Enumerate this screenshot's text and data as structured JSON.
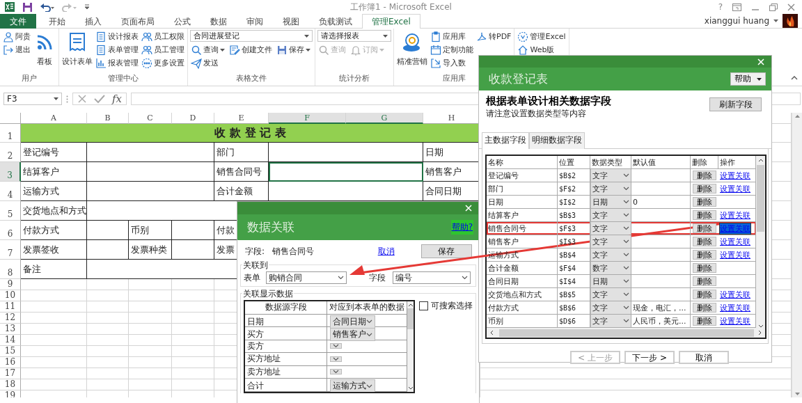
{
  "title_bar": {
    "title": "工作簿1 - Microsoft Excel",
    "help": "?",
    "user": "xianggui huang"
  },
  "ribbon_tabs": [
    {
      "label": "文件",
      "kind": "file",
      "selected": false
    },
    {
      "label": "开始",
      "kind": "tab",
      "selected": false
    },
    {
      "label": "插入",
      "kind": "tab",
      "selected": false
    },
    {
      "label": "页面布局",
      "kind": "tab",
      "selected": false
    },
    {
      "label": "公式",
      "kind": "tab",
      "selected": false
    },
    {
      "label": "数据",
      "kind": "tab",
      "selected": false
    },
    {
      "label": "审阅",
      "kind": "tab",
      "selected": false
    },
    {
      "label": "视图",
      "kind": "tab",
      "selected": false
    },
    {
      "label": "负载测试",
      "kind": "tab",
      "selected": false
    },
    {
      "label": "管理Excel",
      "kind": "tab",
      "selected": true
    }
  ],
  "ribbon_groups": [
    {
      "label": "用户",
      "columns": [
        [
          {
            "label": "阿贵",
            "kind": "small",
            "disabled": false
          },
          {
            "label": "退出",
            "kind": "small",
            "disabled": false
          }
        ],
        [
          {
            "label": "看板",
            "kind": "large",
            "disabled": false
          }
        ]
      ]
    },
    {
      "label": "管理中心",
      "columns": [
        [
          {
            "label": "设计表单",
            "kind": "large",
            "disabled": false
          }
        ],
        [
          {
            "label": "设计报表",
            "kind": "small",
            "disabled": false
          },
          {
            "label": "表单管理",
            "kind": "small",
            "disabled": false
          },
          {
            "label": "报表管理",
            "kind": "small",
            "disabled": false
          }
        ],
        [
          {
            "label": "员工权限",
            "kind": "small",
            "disabled": false
          },
          {
            "label": "员工管理",
            "kind": "small",
            "disabled": false
          },
          {
            "label": "更多设置",
            "kind": "small",
            "disabled": false
          }
        ]
      ]
    },
    {
      "label": "表格文件",
      "items": [
        {
          "label": "合同进展登记",
          "kind": "combo",
          "disabled": false
        },
        {
          "label": "查询",
          "kind": "split",
          "disabled": false
        },
        {
          "label": "创建文件",
          "kind": "small",
          "disabled": false
        },
        {
          "label": "保存",
          "kind": "split",
          "disabled": false
        },
        {
          "label": "发送",
          "kind": "small",
          "disabled": false
        }
      ]
    },
    {
      "label": "统计分析",
      "items": [
        {
          "label": "请选择报表",
          "kind": "combo",
          "disabled": false
        },
        {
          "label": "查询",
          "kind": "small",
          "disabled": true
        },
        {
          "label": "订阅",
          "kind": "split",
          "disabled": true
        }
      ]
    },
    {
      "label": "应用库",
      "columns": [
        [
          {
            "label": "精准营销",
            "kind": "large",
            "disabled": false
          }
        ],
        [
          {
            "label": "应用库",
            "kind": "small",
            "disabled": false
          },
          {
            "label": "定制功能",
            "kind": "small",
            "disabled": false
          },
          {
            "label": "导入数",
            "kind": "small",
            "disabled": false
          }
        ],
        [
          {
            "label": "转PDF",
            "kind": "small",
            "disabled": false
          }
        ]
      ]
    },
    {
      "columns": [
        [
          {
            "label": "管理Excel",
            "kind": "small",
            "disabled": false
          },
          {
            "label": "Web版",
            "kind": "small",
            "disabled": false
          }
        ]
      ]
    }
  ],
  "formula_bar": {
    "name_box": "F3",
    "function_label": "fx"
  },
  "sheet": {
    "columns": [
      {
        "label": "A",
        "selected": false
      },
      {
        "label": "B",
        "selected": false
      },
      {
        "label": "C",
        "selected": false
      },
      {
        "label": "D",
        "selected": false
      },
      {
        "label": "E",
        "selected": false
      },
      {
        "label": "F",
        "selected": true
      },
      {
        "label": "G",
        "selected": true
      },
      {
        "label": "H",
        "selected": false
      }
    ],
    "rows": [
      {
        "label": "1",
        "kind": "title",
        "selected": false,
        "cells": [
          {
            "text": "收 款 登 记 表",
            "selected": false
          }
        ]
      },
      {
        "label": "2",
        "kind": "pair",
        "selected": false,
        "cells": [
          {
            "text": "登记编号",
            "selected": false
          },
          {
            "selected": false
          },
          {
            "text": "部门",
            "selected": false
          },
          {
            "selected": false
          },
          {
            "text": "日期",
            "selected": false
          }
        ]
      },
      {
        "label": "3",
        "kind": "pair",
        "selected": true,
        "cells": [
          {
            "text": "结算客户",
            "selected": false
          },
          {
            "selected": false
          },
          {
            "text": "销售合同号",
            "selected": false
          },
          {
            "selected": true
          },
          {
            "text": "销售客户",
            "selected": false
          }
        ]
      },
      {
        "label": "4",
        "kind": "pair",
        "selected": false,
        "cells": [
          {
            "text": "运输方式",
            "selected": false
          },
          {
            "selected": false
          },
          {
            "text": "合计金额",
            "selected": false
          },
          {
            "selected": false
          },
          {
            "text": "合同日期",
            "selected": false
          }
        ]
      },
      {
        "label": "5",
        "kind": "wide",
        "selected": false,
        "cells": [
          {
            "text": "交货地点和方式",
            "selected": false
          },
          {
            "selected": false
          }
        ]
      },
      {
        "label": "6",
        "kind": "grid",
        "selected": false,
        "cells": [
          {
            "text": "付款方式",
            "selected": false
          },
          {
            "selected": false
          },
          {
            "text": "币别",
            "selected": false
          },
          {
            "selected": false
          },
          {
            "text": "付款",
            "selected": false
          }
        ]
      },
      {
        "label": "7",
        "kind": "grid",
        "selected": false,
        "cells": [
          {
            "text": "发票签收",
            "selected": false
          },
          {
            "selected": false
          },
          {
            "text": "发票种类",
            "selected": false
          },
          {
            "selected": false
          },
          {
            "text": "发票",
            "selected": false
          }
        ]
      },
      {
        "label": "8",
        "kind": "wide",
        "selected": false,
        "cells": [
          {
            "text": "备注",
            "selected": false
          },
          {
            "selected": false
          }
        ]
      },
      {
        "label": "9",
        "kind": "blank",
        "selected": false
      },
      {
        "label": "10",
        "kind": "blank",
        "selected": false
      },
      {
        "label": "11",
        "kind": "blank",
        "selected": false
      },
      {
        "label": "12",
        "kind": "blank",
        "selected": false
      },
      {
        "label": "13",
        "kind": "blank",
        "selected": false
      },
      {
        "label": "14",
        "kind": "blank",
        "selected": false
      },
      {
        "label": "15",
        "kind": "blank",
        "selected": false
      },
      {
        "label": "16",
        "kind": "blank",
        "selected": false
      },
      {
        "label": "17",
        "kind": "blank",
        "selected": false
      },
      {
        "label": "18",
        "kind": "blank",
        "selected": false
      },
      {
        "label": "19",
        "kind": "blank",
        "selected": false
      }
    ]
  },
  "fields_dialog": {
    "title": "收款登记表",
    "help": "帮助",
    "heading": "根据表单设计相关数据字段",
    "note": "请注意设置数据类型等内容",
    "refresh": "刷新字段",
    "tabs": [
      {
        "label": "主数据字段",
        "selected": true
      },
      {
        "label": "明细数据字段",
        "selected": false
      }
    ],
    "columns": [
      "名称",
      "位置",
      "数据类型",
      "默认值",
      "删除",
      "操作"
    ],
    "rows": [
      {
        "name": "登记编号",
        "position": "$B$2",
        "type": "文字",
        "delete": "删除",
        "action": "设置关联",
        "selected": false
      },
      {
        "name": "部门",
        "position": "$F$2",
        "type": "文字",
        "delete": "删除",
        "action": "设置关联",
        "selected": false
      },
      {
        "name": "日期",
        "position": "$I$2",
        "type": "日期",
        "default": "0",
        "delete": "删除",
        "selected": false
      },
      {
        "name": "结算客户",
        "position": "$B$3",
        "type": "文字",
        "delete": "删除",
        "action": "设置关联",
        "selected": false
      },
      {
        "name": "销售合同号",
        "position": "$F$3",
        "type": "文字",
        "delete": "删除",
        "action": "设置关联",
        "selected": true
      },
      {
        "name": "销售客户",
        "position": "$I$3",
        "type": "文字",
        "delete": "删除",
        "action": "设置关联",
        "selected": false
      },
      {
        "name": "运输方式",
        "position": "$B$4",
        "type": "文字",
        "delete": "删除",
        "action": "设置关联",
        "selected": false
      },
      {
        "name": "合计金额",
        "position": "$F$4",
        "type": "数字",
        "delete": "删除",
        "selected": false
      },
      {
        "name": "合同日期",
        "position": "$I$4",
        "type": "日期",
        "delete": "删除",
        "selected": false
      },
      {
        "name": "交货地点和方式",
        "position": "$B$5",
        "type": "文字",
        "delete": "删除",
        "action": "设置关联",
        "selected": false
      },
      {
        "name": "付款方式",
        "position": "$B$6",
        "type": "文字",
        "default": "现金，电汇，...",
        "delete": "删除",
        "action": "设置关联",
        "selected": false
      },
      {
        "name": "币别",
        "position": "$D$6",
        "type": "文字",
        "default": "人民币，美元...",
        "delete": "删除",
        "action": "设置关联",
        "selected": false
      }
    ],
    "buttons": [
      {
        "label": "< 上一步",
        "disabled": true
      },
      {
        "label": "下一步 >",
        "disabled": false
      },
      {
        "label": "取消",
        "disabled": false
      }
    ]
  },
  "link_dialog": {
    "title": "数据关联",
    "help": "帮助?",
    "field_label": "字段:",
    "field_value": "销售合同号",
    "cancel": "取消",
    "save": "保存",
    "link_to": {
      "legend": "关联到",
      "form_label": "表单",
      "form_value": "购销合同",
      "field_label": "字段",
      "field_value": "编号"
    },
    "display": {
      "legend": "关联显示数据",
      "columns": [
        "数据源字段",
        "对应到本表单的数据"
      ],
      "rows": [
        {
          "source": "日期",
          "target": "合同日期"
        },
        {
          "source": "买方",
          "target": "销售客户"
        },
        {
          "source": "卖方"
        },
        {
          "source": "买方地址"
        },
        {
          "source": "卖方地址"
        },
        {
          "source": "合计",
          "target": "运输方式"
        }
      ],
      "searchable": {
        "label": "可搜索选择",
        "checked": false
      }
    }
  }
}
